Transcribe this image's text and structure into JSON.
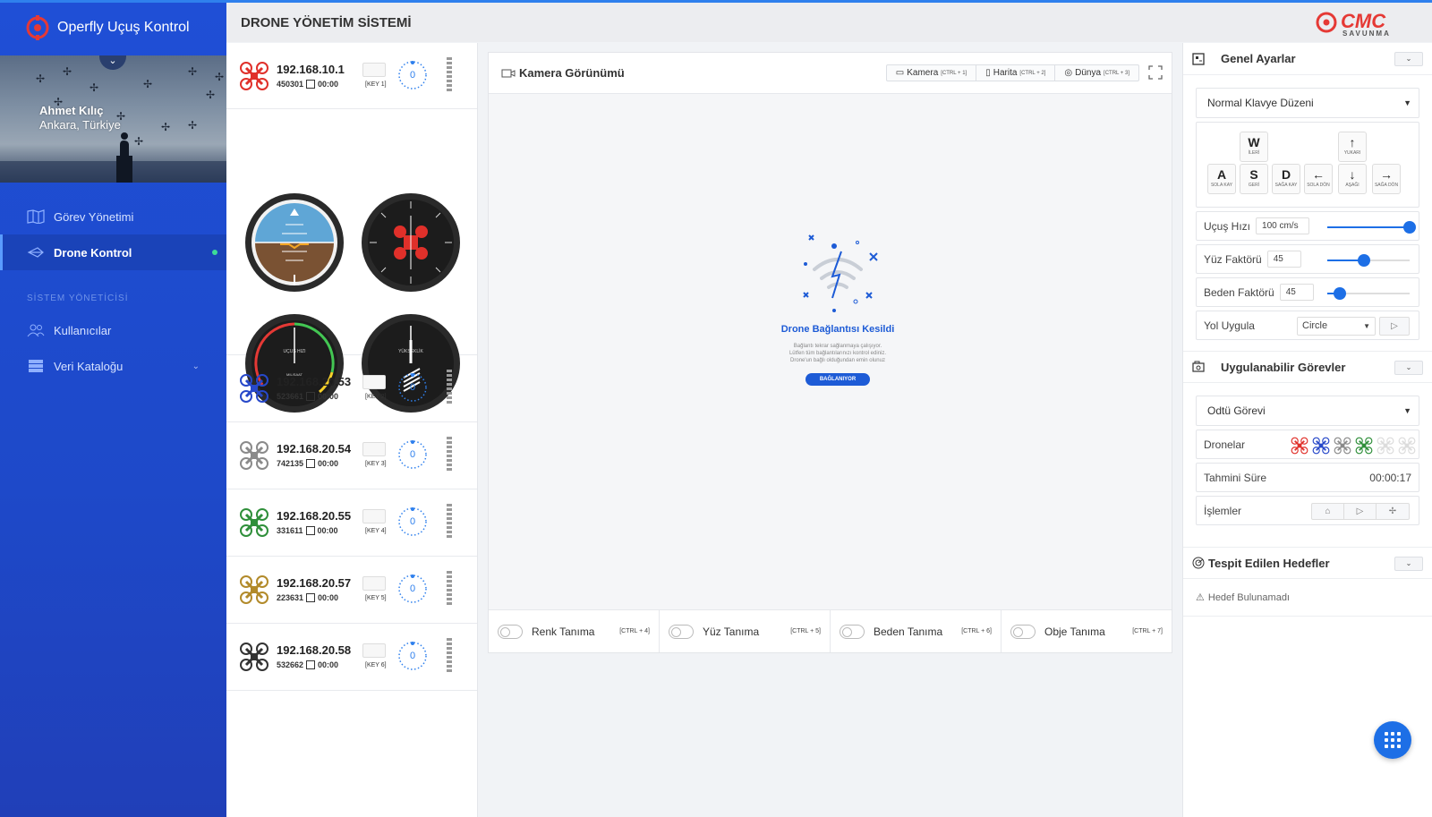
{
  "app": {
    "brand": "Operfly Uçuş Kontrol",
    "header_title": "DRONE YÖNETİM SİSTEMİ",
    "logo_text": "CMC",
    "logo_sub": "SAVUNMA"
  },
  "profile": {
    "name": "Ahmet Kılıç",
    "location": "Ankara, Türkiye"
  },
  "nav": {
    "items": [
      {
        "label": "Görev Yönetimi",
        "icon": "map-icon"
      },
      {
        "label": "Drone Kontrol",
        "icon": "drone-icon"
      }
    ],
    "section_title": "SİSTEM YÖNETİCİSİ",
    "admin_items": [
      {
        "label": "Kullanıcılar",
        "icon": "users-icon"
      },
      {
        "label": "Veri Kataloğu",
        "icon": "database-icon"
      }
    ]
  },
  "drones": [
    {
      "ip": "192.168.10.1",
      "id": "450301",
      "time": "00:00",
      "key": "[KEY 1]",
      "ring": "0",
      "color": "#e0302a"
    },
    {
      "ip": "192.168.20.53",
      "id": "523661",
      "time": "00:00",
      "key": "[KEY 2]",
      "ring": "0",
      "color": "#2748c9"
    },
    {
      "ip": "192.168.20.54",
      "id": "742135",
      "time": "00:00",
      "key": "[KEY 3]",
      "ring": "0",
      "color": "#8a8a8a"
    },
    {
      "ip": "192.168.20.55",
      "id": "331611",
      "time": "00:00",
      "key": "[KEY 4]",
      "ring": "0",
      "color": "#2f8f3a"
    },
    {
      "ip": "192.168.20.57",
      "id": "223631",
      "time": "00:00",
      "key": "[KEY 5]",
      "ring": "0",
      "color": "#b28a2a"
    },
    {
      "ip": "192.168.20.58",
      "id": "532662",
      "time": "00:00",
      "key": "[KEY 6]",
      "ring": "0",
      "color": "#333333"
    }
  ],
  "gauges": {
    "speed_label": "UÇUŞ HIZI",
    "speed_unit": "MIL/SAAT",
    "altitude_label": "YÜKSEKLİK"
  },
  "camera": {
    "title": "Kamera Görünümü",
    "tabs": [
      {
        "label": "Kamera",
        "shortcut": "[CTRL + 1]"
      },
      {
        "label": "Harita",
        "shortcut": "[CTRL + 2]"
      },
      {
        "label": "Dünya",
        "shortcut": "[CTRL + 3]"
      }
    ],
    "lost_title": "Drone Bağlantısı Kesildi",
    "lost_lines": [
      "Bağlantı tekrar sağlanmaya çalışıyor.",
      "Lütfen tüm bağlantılarınızı kontrol ediniz.",
      "Drone'un bağlı olduğundan emin olunuz"
    ],
    "lost_button": "BAĞLANIYOR",
    "recognition": [
      {
        "label": "Renk Tanıma",
        "shortcut": "[CTRL + 4]"
      },
      {
        "label": "Yüz Tanıma",
        "shortcut": "[CTRL + 5]"
      },
      {
        "label": "Beden Tanıma",
        "shortcut": "[CTRL + 6]"
      },
      {
        "label": "Obje Tanıma",
        "shortcut": "[CTRL + 7]"
      }
    ]
  },
  "settings": {
    "title": "Genel Ayarlar",
    "layout_select": "Normal Klavye Düzeni",
    "keys": {
      "w": "W",
      "w_sub": "İLERİ",
      "a": "A",
      "a_sub": "SOLA KAY",
      "s": "S",
      "s_sub": "GERİ",
      "d": "D",
      "d_sub": "SAĞA KAY",
      "left": "←",
      "left_sub": "SOLA DÖN",
      "up": "↑",
      "up_sub": "YUKARI",
      "down": "↓",
      "down_sub": "AŞAĞI",
      "right": "→",
      "right_sub": "SAĞA DÖN"
    },
    "speed_label": "Uçuş Hızı",
    "speed_value": "100 cm/s",
    "speed_level": 1.0,
    "face_label": "Yüz Faktörü",
    "face_value": "45",
    "face_level": 0.45,
    "body_label": "Beden Faktörü",
    "body_value": "45",
    "body_level": 0.15,
    "path_label": "Yol Uygula",
    "path_value": "Circle"
  },
  "tasks": {
    "title": "Uygulanabilir Görevler",
    "task_select": "Odtü Görevi",
    "drones_label": "Dronelar",
    "eta_label": "Tahmini Süre",
    "eta_value": "00:00:17",
    "ops_label": "İşlemler"
  },
  "targets": {
    "title": "Tespit Edilen Hedefler",
    "empty": "Hedef Bulunamadı"
  }
}
